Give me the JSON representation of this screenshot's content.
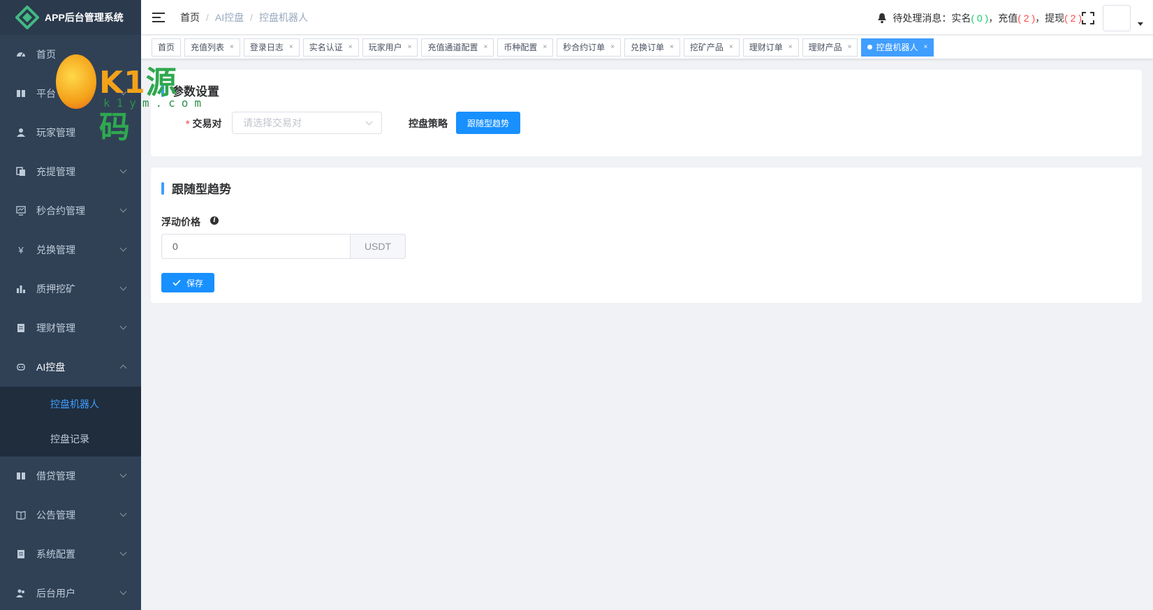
{
  "brand": {
    "title": "APP后台管理系统"
  },
  "sidebar": {
    "items": [
      {
        "label": "首页",
        "icon": "dashboard-icon"
      },
      {
        "label": "平台",
        "icon": "book-icon"
      },
      {
        "label": "玩家管理",
        "icon": "user-icon"
      },
      {
        "label": "充提管理",
        "icon": "copy-icon"
      },
      {
        "label": "秒合约管理",
        "icon": "monitor-icon"
      },
      {
        "label": "兑换管理",
        "icon": "yen-icon"
      },
      {
        "label": "质押挖矿",
        "icon": "bar-chart-icon"
      },
      {
        "label": "理财管理",
        "icon": "document-icon"
      },
      {
        "label": "AI控盘",
        "icon": "robot-icon"
      },
      {
        "label": "借贷管理",
        "icon": "book-icon"
      },
      {
        "label": "公告管理",
        "icon": "open-book-icon"
      },
      {
        "label": "系统配置",
        "icon": "document-icon"
      },
      {
        "label": "后台用户",
        "icon": "users-icon"
      }
    ],
    "sub_items": [
      {
        "label": "控盘机器人"
      },
      {
        "label": "控盘记录"
      }
    ]
  },
  "header": {
    "breadcrumb": [
      "首页",
      "AI控盘",
      "控盘机器人"
    ],
    "notice": {
      "prefix": "待处理消息：实名",
      "realname_count": "( 0 )",
      "recharge_label": "，充值",
      "recharge_count": "( 2 )",
      "withdraw_label": "，提现",
      "withdraw_count": "( 2 )"
    }
  },
  "tags": [
    {
      "label": "首页"
    },
    {
      "label": "充值列表"
    },
    {
      "label": "登录日志"
    },
    {
      "label": "实名认证"
    },
    {
      "label": "玩家用户"
    },
    {
      "label": "充值通道配置"
    },
    {
      "label": "币种配置"
    },
    {
      "label": "秒合约订单"
    },
    {
      "label": "兑换订单"
    },
    {
      "label": "挖矿产品"
    },
    {
      "label": "理财订单"
    },
    {
      "label": "理财产品"
    },
    {
      "label": "控盘机器人"
    }
  ],
  "params_card": {
    "title": "参数设置",
    "pair_label": "交易对",
    "pair_placeholder": "请选择交易对",
    "strategy_label": "控盘策略",
    "strategy_button": "跟随型趋势"
  },
  "trend_card": {
    "title": "跟随型趋势",
    "price_label": "浮动价格",
    "price_value": "0",
    "price_unit": "USDT",
    "save_button": "保存"
  },
  "watermark": {
    "main": "K1",
    "cn": "源码",
    "sub": "k1ym.com"
  },
  "colors": {
    "sidebar_bg": "#304156",
    "primary": "#409eff",
    "danger": "#ff4949",
    "success": "#13ce66"
  }
}
